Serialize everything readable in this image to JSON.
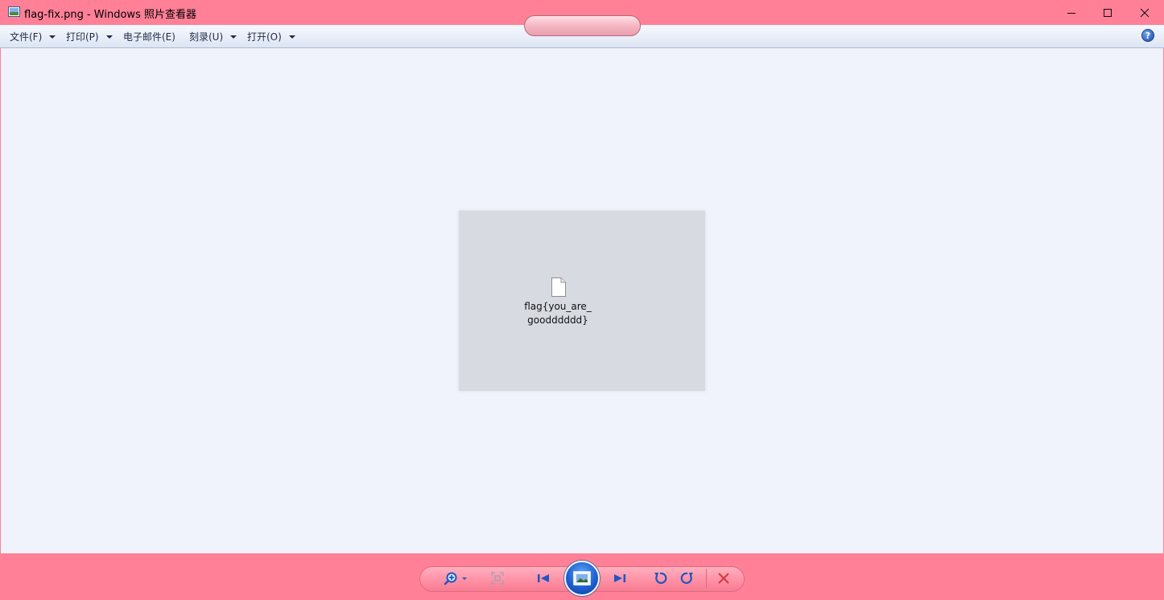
{
  "window": {
    "title": "flag-fix.png - Windows 照片查看器",
    "minimize_glyph": "minimize-icon",
    "maximize_glyph": "maximize-icon",
    "close_glyph": "close-icon"
  },
  "menu": {
    "items": [
      {
        "label": "文件(F)",
        "has_dropdown": true
      },
      {
        "label": "打印(P)",
        "has_dropdown": true
      },
      {
        "label": "电子邮件(E)",
        "has_dropdown": false
      },
      {
        "label": "刻录(U)",
        "has_dropdown": true
      },
      {
        "label": "打开(O)",
        "has_dropdown": true
      }
    ],
    "help": "?"
  },
  "image": {
    "file_label": "flag{you_are_goodddddd}"
  },
  "toolbar": {
    "buttons": [
      "zoom-icon",
      "actual-size-icon",
      "previous-icon",
      "slideshow-icon",
      "next-icon",
      "rotate-counterclockwise-icon",
      "rotate-clockwise-icon",
      "delete-icon"
    ]
  },
  "colors": {
    "chrome": "#ff8097",
    "viewer_bg": "#f0f3fb",
    "image_bg": "#d8dae2",
    "delete_red": "#d23a3a",
    "icon_blue": "#1f56c2"
  }
}
